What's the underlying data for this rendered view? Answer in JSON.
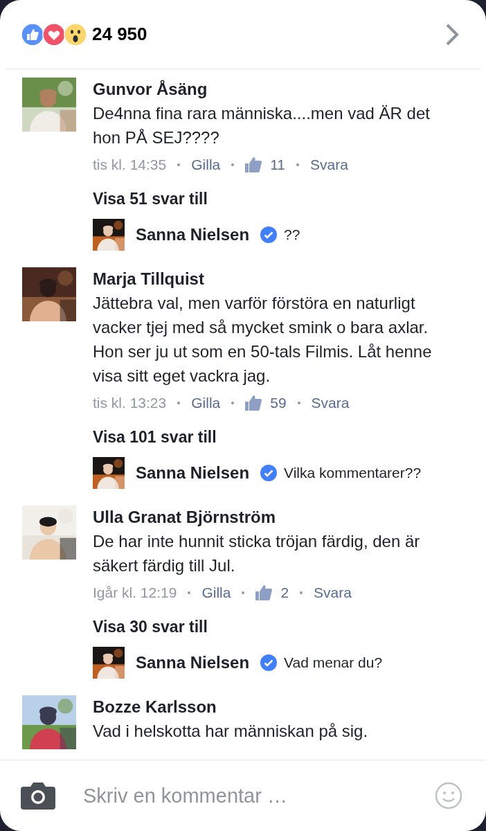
{
  "reactions": {
    "count": "24 950"
  },
  "comments": [
    {
      "author": "Gunvor Åsäng",
      "text": "De4nna fina rara människa....men vad ÄR det hon PÅ SEJ????",
      "time": "tis kl. 14:35",
      "like_label": "Gilla",
      "like_count": "11",
      "reply_label": "Svara",
      "more_replies": "Visa 51 svar till",
      "reply": {
        "author": "Sanna Nielsen",
        "verified": true,
        "text": "??"
      }
    },
    {
      "author": "Marja Tillquist",
      "text": "Jättebra val, men varför förstöra en naturligt vacker  tjej med så mycket smink o bara axlar. Hon ser ju ut som en 50-tals Filmis. Låt henne visa sitt eget vackra jag.",
      "time": "tis kl. 13:23",
      "like_label": "Gilla",
      "like_count": "59",
      "reply_label": "Svara",
      "more_replies": "Visa 101 svar till",
      "reply": {
        "author": "Sanna Nielsen",
        "verified": true,
        "text": "Vilka kommentarer??"
      }
    },
    {
      "author": "Ulla Granat Björnström",
      "text": "De har inte hunnit sticka tröjan färdig, den är säkert färdig till Jul.",
      "time": "Igår kl. 12:19",
      "like_label": "Gilla",
      "like_count": "2",
      "reply_label": "Svara",
      "more_replies": "Visa 30 svar till",
      "reply": {
        "author": "Sanna Nielsen",
        "verified": true,
        "text": "Vad menar du?"
      }
    },
    {
      "author": "Bozze Karlsson",
      "text": "Vad i helskotta har människan på sig."
    }
  ],
  "composer": {
    "placeholder": "Skriv en kommentar …"
  }
}
